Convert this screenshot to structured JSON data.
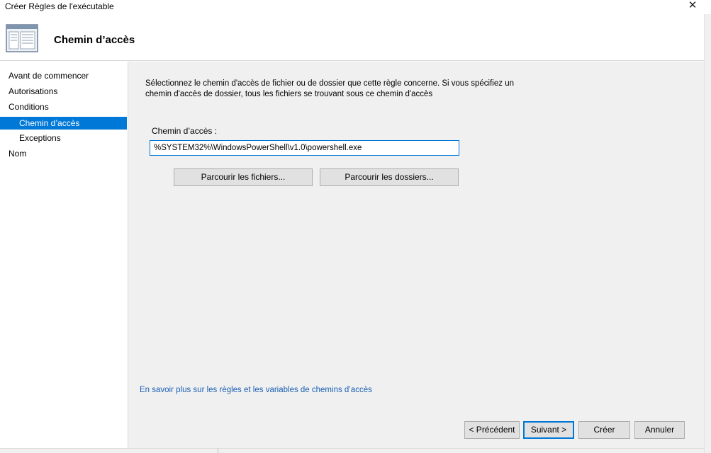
{
  "window": {
    "title": "Créer Règles de l'exécutable",
    "close_glyph": "✕"
  },
  "header": {
    "title": "Chemin d’accès",
    "icon": "wizard-window-icon"
  },
  "sidebar": {
    "items": [
      {
        "label": "Avant de commencer",
        "indent": false,
        "selected": false
      },
      {
        "label": "Autorisations",
        "indent": false,
        "selected": false
      },
      {
        "label": "Conditions",
        "indent": false,
        "selected": false
      },
      {
        "label": "Chemin d’accès",
        "indent": true,
        "selected": true
      },
      {
        "label": "Exceptions",
        "indent": true,
        "selected": false
      },
      {
        "label": "Nom",
        "indent": false,
        "selected": false
      }
    ]
  },
  "main": {
    "description": "Sélectionnez le chemin d'accès de fichier ou de dossier que cette règle concerne. Si vous spécifiez un chemin d'accès de dossier, tous les fichiers se trouvant sous ce chemin d'accès",
    "path_label": "Chemin d’accès :",
    "path_value": "%SYSTEM32%\\WindowsPowerShell\\v1.0\\powershell.exe",
    "browse_files_label": "Parcourir les fichiers...",
    "browse_folders_label": "Parcourir les dossiers...",
    "help_link": "En savoir plus sur les règles et les variables de chemins d’accès"
  },
  "footer": {
    "prev_label": "< Précédent",
    "next_label": "Suivant >",
    "create_label": "Créer",
    "cancel_label": "Annuler"
  },
  "colors": {
    "selection": "#0078d7",
    "link": "#1a5fb4",
    "panel": "#f0f0f0",
    "button": "#e1e1e1"
  }
}
